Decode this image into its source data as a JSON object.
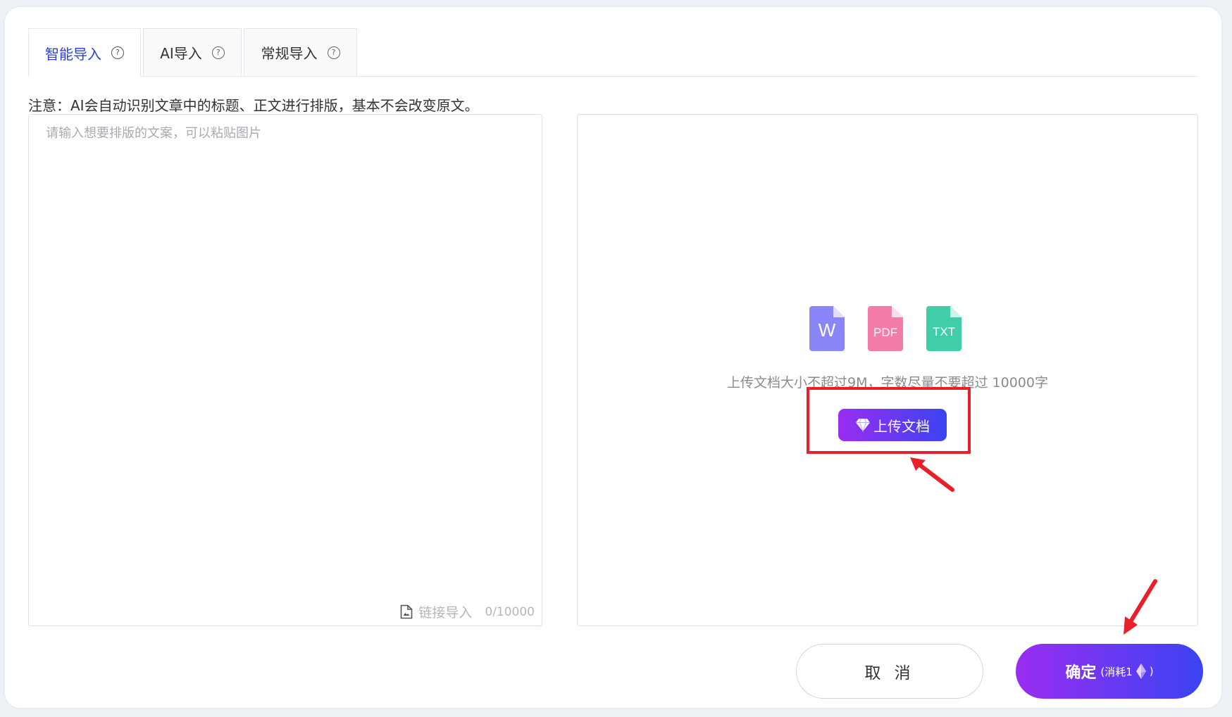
{
  "tabs": [
    {
      "label": "智能导入",
      "active": true
    },
    {
      "label": "AI导入",
      "active": false
    },
    {
      "label": "常规导入",
      "active": false
    }
  ],
  "notice": "注意：AI会自动识别文章中的标题、正文进行排版，基本不会改变原文。",
  "editor": {
    "placeholder": "请输入想要排版的文案，可以粘贴图片",
    "value": "",
    "link_import": "链接导入",
    "counter": "0/10000"
  },
  "upload": {
    "file_types": [
      "W",
      "PDF",
      "TXT"
    ],
    "hint": "上传文档大小不超过9M，字数尽量不要超过 10000字",
    "button_label": "上传文档"
  },
  "footer": {
    "cancel": "取 消",
    "confirm": "确定",
    "cost_open": "(消耗1",
    "cost_close": ")"
  },
  "colors": {
    "accent_tab": "#2b3fe0",
    "gradient_start": "#9a2df2",
    "gradient_end": "#3b43f2",
    "annotation_red": "#e8202a",
    "word_icon": "#8b86f7",
    "pdf_icon": "#f47cab",
    "txt_icon": "#3fcea7"
  }
}
